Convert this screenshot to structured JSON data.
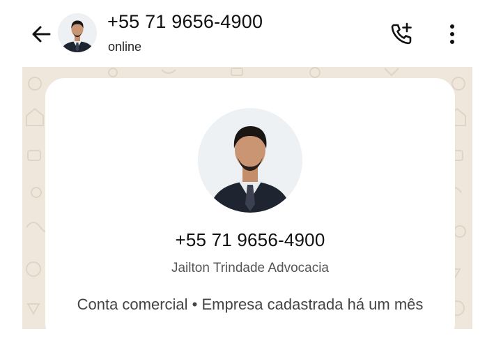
{
  "header": {
    "title": "+55 71 9656-4900",
    "status": "online",
    "back_icon": "arrow-left-icon",
    "call_icon": "add-call-icon",
    "menu_icon": "more-vert-icon"
  },
  "card": {
    "phone": "+55 71 9656-4900",
    "name": "Jailton Trindade Advocacia",
    "info": "Conta comercial • Empresa cadastrada há um mês"
  },
  "colors": {
    "chat_background": "#efe7dc",
    "card_background": "#ffffff",
    "header_background": "#ffffff"
  }
}
